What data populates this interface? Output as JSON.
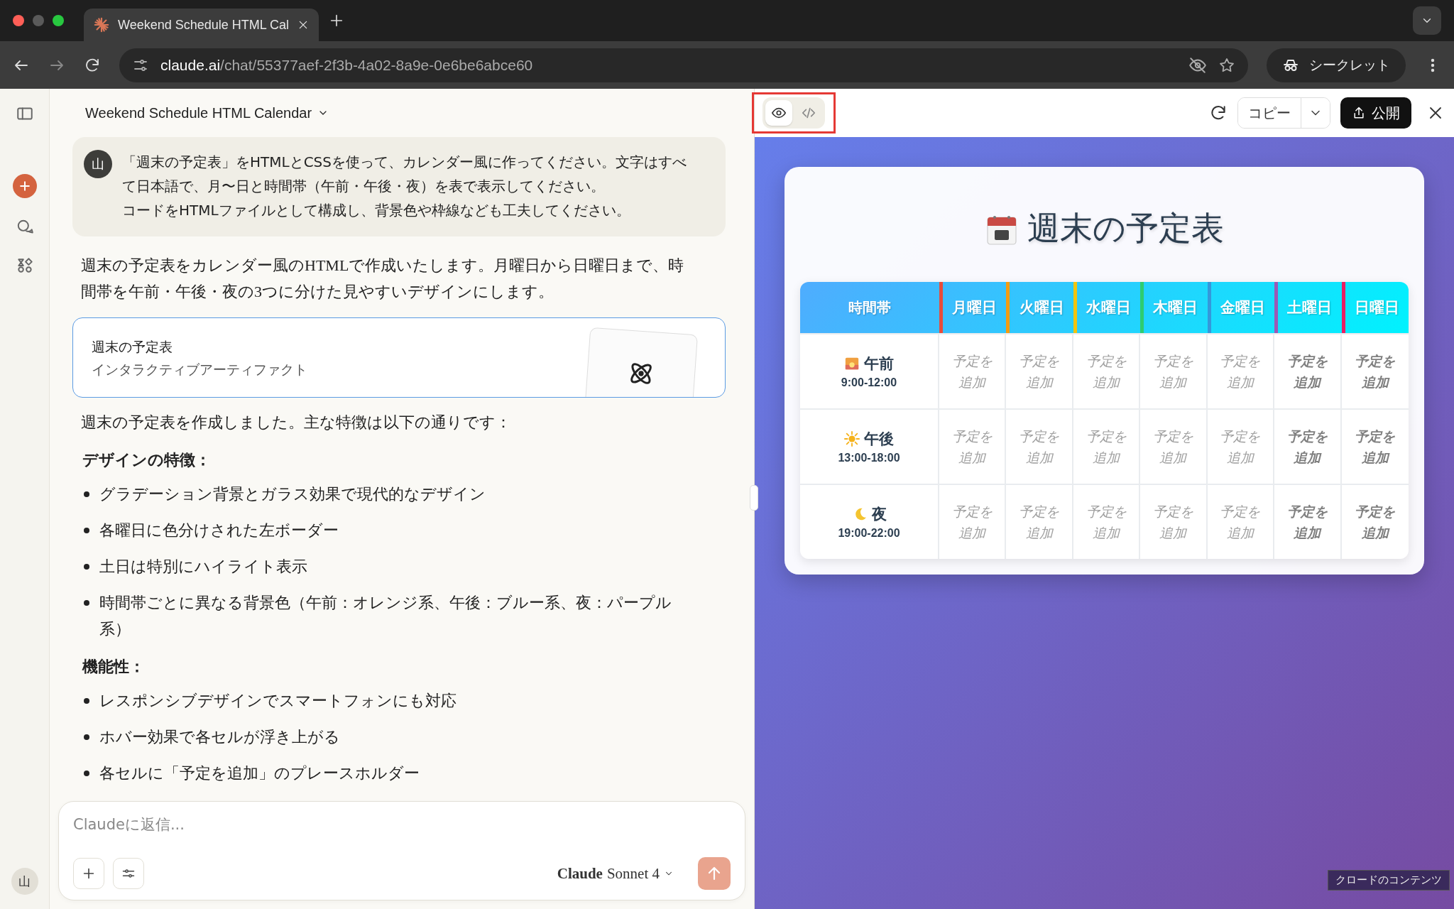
{
  "browser": {
    "tab_title": "Weekend Schedule HTML Cal",
    "url_host": "claude.ai",
    "url_path": "/chat/55377aef-2f3b-4a02-8a9e-0e6be6abce60",
    "incognito_label": "シークレット"
  },
  "sidebar": {
    "avatar": "山"
  },
  "chat": {
    "title": "Weekend Schedule HTML Calendar",
    "user_avatar": "山",
    "user_message": [
      "「週末の予定表」をHTMLとCSSを使って、カレンダー風に作ってください。文字はすべて日本語で、月〜日と時間帯（午前・午後・夜）を表で表示してください。",
      "コードをHTMLファイルとして構成し、背景色や枠線なども工夫してください。"
    ],
    "intro": "週末の予定表をカレンダー風のHTMLで作成いたします。月曜日から日曜日まで、時間帯を午前・午後・夜の3つに分けた見やすいデザインにします。",
    "artifact": {
      "title": "週末の予定表",
      "subtitle": "インタラクティブアーティファクト"
    },
    "summary": "週末の予定表を作成しました。主な特徴は以下の通りです：",
    "sections": [
      {
        "heading": "デザインの特徴：",
        "items": [
          "グラデーション背景とガラス効果で現代的なデザイン",
          "各曜日に色分けされた左ボーダー",
          "土日は特別にハイライト表示",
          "時間帯ごとに異なる背景色（午前：オレンジ系、午後：ブルー系、夜：パープル系）"
        ]
      },
      {
        "heading": "機能性：",
        "items": [
          "レスポンシブデザインでスマートフォンにも対応",
          "ホバー効果で各セルが浮き上がる",
          "各セルに「予定を追加」のプレースホルダー"
        ]
      }
    ],
    "composer": {
      "placeholder": "Claudeに返信...",
      "model": "**Claude** Sonnet 4"
    }
  },
  "artifact_panel": {
    "highlighted": true,
    "view_modes": [
      {
        "kind": "preview",
        "selected": true
      },
      {
        "kind": "code",
        "selected": false
      }
    ],
    "copy_label": "コピー",
    "publish_label": "公開",
    "page": {
      "title": "週末の予定表",
      "corner_label": "時間帯",
      "days": [
        {
          "label": "月曜日",
          "color": "#e74c3c",
          "weekend": false
        },
        {
          "label": "火曜日",
          "color": "#f39c12",
          "weekend": false
        },
        {
          "label": "水曜日",
          "color": "#f1c40f",
          "weekend": false
        },
        {
          "label": "木曜日",
          "color": "#2ecc71",
          "weekend": false
        },
        {
          "label": "金曜日",
          "color": "#3498db",
          "weekend": false
        },
        {
          "label": "土曜日",
          "color": "#9b59b6",
          "weekend": true
        },
        {
          "label": "日曜日",
          "color": "#e91e63",
          "weekend": true
        }
      ],
      "slots": [
        {
          "kind": "morning",
          "name": "午前",
          "time": "9:00-12:00",
          "cells": [
            "予定を追加",
            "予定を追加",
            "予定を追加",
            "予定を追加",
            "予定を追加",
            "予定を追加",
            "予定を追加"
          ]
        },
        {
          "kind": "afternoon",
          "name": "午後",
          "time": "13:00-18:00",
          "cells": [
            "予定を追加",
            "予定を追加",
            "予定を追加",
            "予定を追加",
            "予定を追加",
            "予定を追加",
            "予定を追加"
          ]
        },
        {
          "kind": "night",
          "name": "夜",
          "time": "19:00-22:00",
          "cells": [
            "予定を追加",
            "予定を追加",
            "予定を追加",
            "予定を追加",
            "予定を追加",
            "予定を追加",
            "予定を追加"
          ]
        }
      ]
    },
    "content_label": "クロードのコンテンツ"
  }
}
